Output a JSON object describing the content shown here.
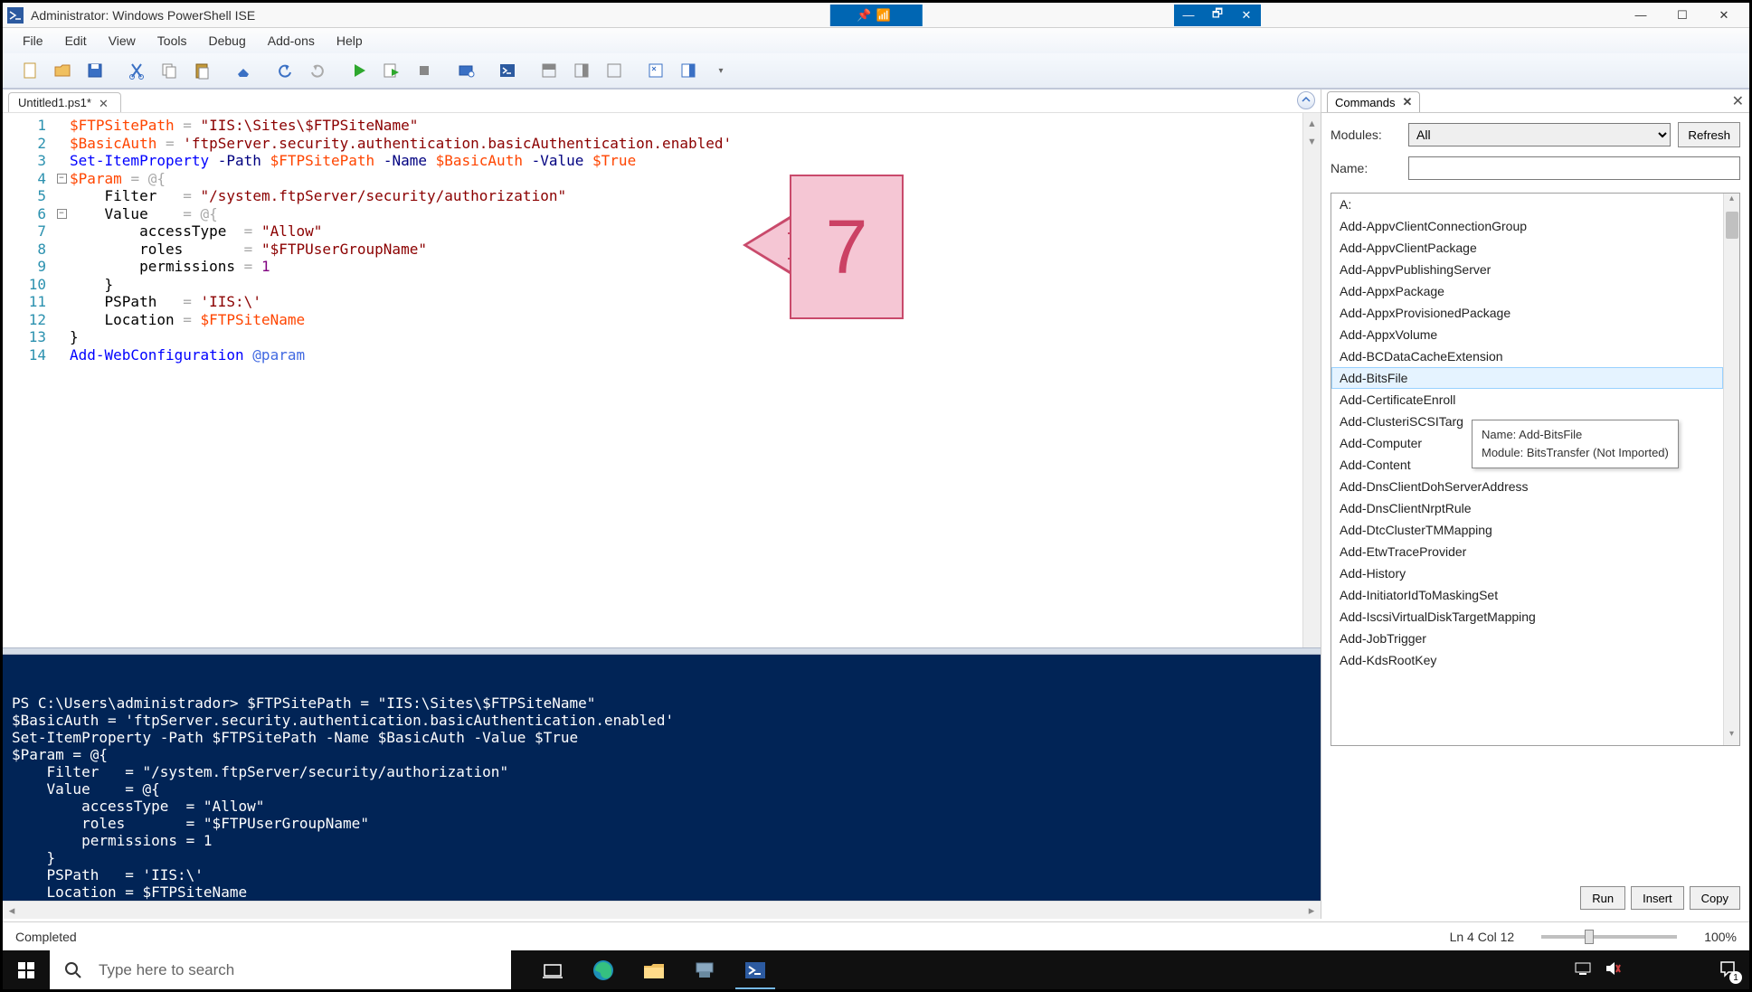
{
  "title": "Administrator: Windows PowerShell ISE",
  "menu": [
    "File",
    "Edit",
    "View",
    "Tools",
    "Debug",
    "Add-ons",
    "Help"
  ],
  "tab": {
    "label": "Untitled1.ps1*"
  },
  "callout": {
    "number": "7"
  },
  "code_lines": [
    {
      "n": 1,
      "html": "<span class='tok-var'>$FTPSitePath</span> <span class='tok-op'>=</span> <span class='tok-str'>\"IIS:\\Sites\\$FTPSiteName\"</span>"
    },
    {
      "n": 2,
      "html": "<span class='tok-var'>$BasicAuth</span> <span class='tok-op'>=</span> <span class='tok-str'>'ftpServer.security.authentication.basicAuthentication.enabled'</span>"
    },
    {
      "n": 3,
      "html": "<span class='tok-cmd'>Set-ItemProperty</span> <span class='tok-param'>-Path</span> <span class='tok-var'>$FTPSitePath</span> <span class='tok-param'>-Name</span> <span class='tok-var'>$BasicAuth</span> <span class='tok-param'>-Value</span> <span class='tok-var'>$True</span>"
    },
    {
      "n": 4,
      "html": "<span class='tok-var'>$Param</span> <span class='tok-op'>=</span> <span class='tok-op'>@{</span>"
    },
    {
      "n": 5,
      "html": "    Filter   <span class='tok-op'>=</span> <span class='tok-str'>\"/system.ftpServer/security/authorization\"</span>"
    },
    {
      "n": 6,
      "html": "    Value    <span class='tok-op'>=</span> <span class='tok-op'>@{</span>"
    },
    {
      "n": 7,
      "html": "        accessType  <span class='tok-op'>=</span> <span class='tok-str'>\"Allow\"</span>"
    },
    {
      "n": 8,
      "html": "        roles       <span class='tok-op'>=</span> <span class='tok-str'>\"$FTPUserGroupName\"</span>"
    },
    {
      "n": 9,
      "html": "        permissions <span class='tok-op'>=</span> <span class='tok-num'>1</span>"
    },
    {
      "n": 10,
      "html": "    }"
    },
    {
      "n": 11,
      "html": "    PSPath   <span class='tok-op'>=</span> <span class='tok-str'>'IIS:\\'</span>"
    },
    {
      "n": 12,
      "html": "    Location <span class='tok-op'>=</span> <span class='tok-var'>$FTPSiteName</span>"
    },
    {
      "n": 13,
      "html": "}"
    },
    {
      "n": 14,
      "html": "<span class='tok-cmd'>Add-WebConfiguration</span> <span class='tok-splat'>@param</span>"
    }
  ],
  "fold_markers": {
    "4": "-",
    "6": "-"
  },
  "console_text": "PS C:\\Users\\administrador> $FTPSitePath = \"IIS:\\Sites\\$FTPSiteName\"\n$BasicAuth = 'ftpServer.security.authentication.basicAuthentication.enabled'\nSet-ItemProperty -Path $FTPSitePath -Name $BasicAuth -Value $True\n$Param = @{\n    Filter   = \"/system.ftpServer/security/authorization\"\n    Value    = @{\n        accessType  = \"Allow\"\n        roles       = \"$FTPUserGroupName\"\n        permissions = 1\n    }\n    PSPath   = 'IIS:\\'\n    Location = $FTPSiteName\n}\nAdd-WebConfiguration @param",
  "commands": {
    "tab_label": "Commands",
    "modules_label": "Modules:",
    "modules_value": "All",
    "name_label": "Name:",
    "name_value": "",
    "refresh": "Refresh",
    "list": [
      "A:",
      "Add-AppvClientConnectionGroup",
      "Add-AppvClientPackage",
      "Add-AppvPublishingServer",
      "Add-AppxPackage",
      "Add-AppxProvisionedPackage",
      "Add-AppxVolume",
      "Add-BCDataCacheExtension",
      "Add-BitsFile",
      "Add-CertificateEnroll",
      "Add-ClusteriSCSITarg",
      "Add-Computer",
      "Add-Content",
      "Add-DnsClientDohServerAddress",
      "Add-DnsClientNrptRule",
      "Add-DtcClusterTMMapping",
      "Add-EtwTraceProvider",
      "Add-History",
      "Add-InitiatorIdToMaskingSet",
      "Add-IscsiVirtualDiskTargetMapping",
      "Add-JobTrigger",
      "Add-KdsRootKey"
    ],
    "selected_index": 8,
    "tooltip": {
      "line1": "Name: Add-BitsFile",
      "line2": "Module: BitsTransfer (Not Imported)"
    },
    "actions": {
      "run": "Run",
      "insert": "Insert",
      "copy": "Copy"
    }
  },
  "status": {
    "left": "Completed",
    "position": "Ln 4  Col 12",
    "zoom": "100%"
  },
  "taskbar": {
    "search_placeholder": "Type here to search",
    "notif_count": "1"
  }
}
